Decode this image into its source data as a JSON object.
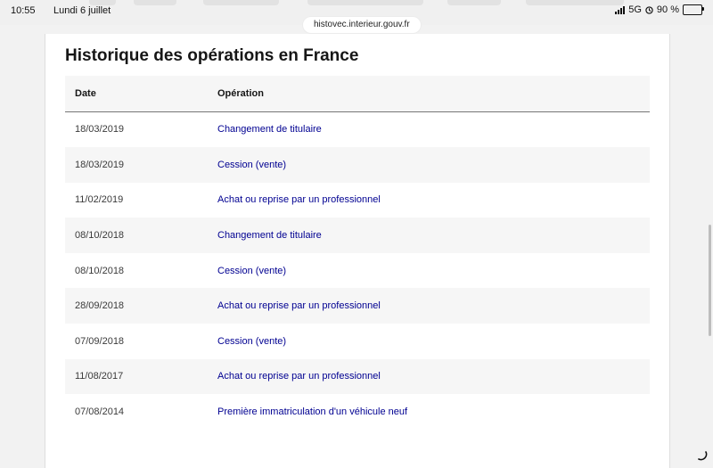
{
  "status_bar": {
    "time": "10:55",
    "date": "Lundi 6 juillet",
    "network": "5G",
    "battery": "90 %",
    "battery_level": 0.9
  },
  "browser": {
    "url": "histovec.interieur.gouv.fr"
  },
  "section": {
    "title": "Historique des opérations en France",
    "columns": [
      "Date",
      "Opération"
    ],
    "rows": [
      {
        "date": "18/03/2019",
        "operation": "Changement de titulaire"
      },
      {
        "date": "18/03/2019",
        "operation": "Cession (vente)"
      },
      {
        "date": "11/02/2019",
        "operation": "Achat ou reprise par un professionnel"
      },
      {
        "date": "08/10/2018",
        "operation": "Changement de titulaire"
      },
      {
        "date": "08/10/2018",
        "operation": "Cession (vente)"
      },
      {
        "date": "28/09/2018",
        "operation": "Achat ou reprise par un professionnel"
      },
      {
        "date": "07/09/2018",
        "operation": "Cession (vente)"
      },
      {
        "date": "11/08/2017",
        "operation": "Achat ou reprise par un professionnel"
      },
      {
        "date": "07/08/2014",
        "operation": "Première immatriculation d'un véhicule neuf"
      }
    ]
  },
  "colors": {
    "link": "#000091",
    "header_bg": "#f6f6f6"
  },
  "icons": [
    "signal-icon",
    "clock-icon",
    "battery-icon",
    "loading-spinner-icon"
  ]
}
